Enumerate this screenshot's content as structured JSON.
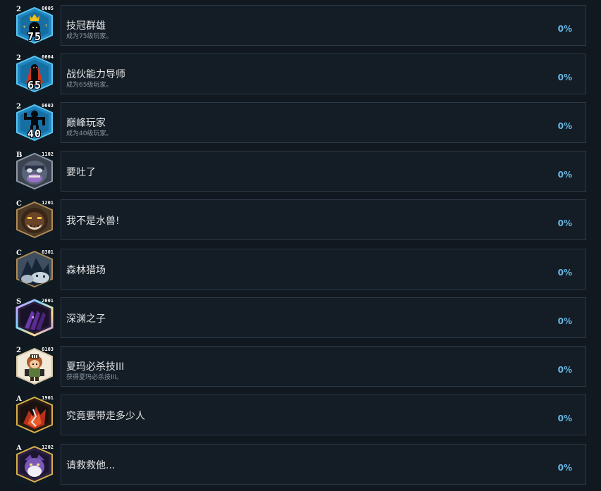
{
  "accent_color": "#67b8e6",
  "achievements": [
    {
      "title": "技冠群雄",
      "desc": "成为75级玩家。",
      "percent": "0%",
      "tier": "2",
      "code": "0005",
      "level": "75",
      "icon": "crowned-player-icon"
    },
    {
      "title": "战伙能力导师",
      "desc": "成为65级玩家。",
      "percent": "0%",
      "tier": "2",
      "code": "0004",
      "level": "65",
      "icon": "caped-player-icon"
    },
    {
      "title": "巅峰玩家",
      "desc": "成为40级玩家。",
      "percent": "0%",
      "tier": "2",
      "code": "0003",
      "level": "40",
      "icon": "flexing-player-icon"
    },
    {
      "title": "要吐了",
      "desc": "",
      "percent": "0%",
      "tier": "B",
      "code": "1102",
      "level": "",
      "icon": "ogre-face-icon"
    },
    {
      "title": "我不是水兽!",
      "desc": "",
      "percent": "0%",
      "tier": "C",
      "code": "1201",
      "level": "",
      "icon": "grinning-beast-icon"
    },
    {
      "title": "森林猎场",
      "desc": "",
      "percent": "0%",
      "tier": "C",
      "code": "0301",
      "level": "",
      "icon": "forest-hunt-icon"
    },
    {
      "title": "深渊之子",
      "desc": "",
      "percent": "0%",
      "tier": "S",
      "code": "2001",
      "level": "",
      "icon": "abyss-claw-icon"
    },
    {
      "title": "夏玛必杀技III",
      "desc": "获得夏玛必杀技III。",
      "percent": "0%",
      "tier": "2",
      "code": "0103",
      "level": "",
      "icon": "shama-girl-icon"
    },
    {
      "title": "究竟要带走多少人",
      "desc": "",
      "percent": "0%",
      "tier": "A",
      "code": "1901",
      "level": "",
      "icon": "fiery-demon-icon"
    },
    {
      "title": "请救救他...",
      "desc": "",
      "percent": "0%",
      "tier": "A",
      "code": "1202",
      "level": "",
      "icon": "purple-creature-icon"
    }
  ]
}
